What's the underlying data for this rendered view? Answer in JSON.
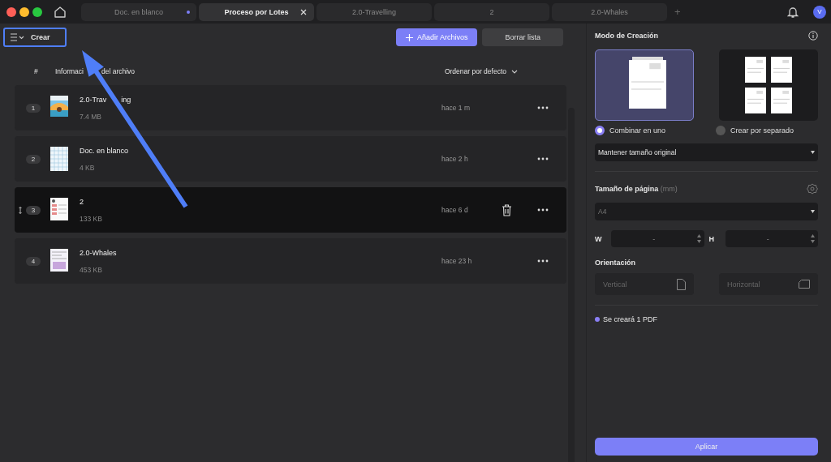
{
  "tabs": [
    {
      "label": "Doc. en blanco",
      "selected": false,
      "unsaved": true
    },
    {
      "label": "Proceso por Lotes",
      "selected": true,
      "unsaved": false
    },
    {
      "label": "2.0-Travelling",
      "selected": false,
      "unsaved": false
    },
    {
      "label": "2",
      "selected": false,
      "unsaved": false
    },
    {
      "label": "2.0-Whales",
      "selected": false,
      "unsaved": false
    }
  ],
  "new_tab": "+",
  "avatar": "V",
  "toolbar": {
    "menu_label": "Crear",
    "add_button": "Añadir Archivos",
    "clear_button": "Borrar lista"
  },
  "table": {
    "columns": [
      {
        "label_parts": [
          "#"
        ]
      },
      {
        "label_parts": [
          "Informaci",
          "del archivo"
        ]
      }
    ],
    "sort": "Ordenar por defecto",
    "rows": [
      {
        "index": "1",
        "name_parts": [
          "2.0-Trav",
          "ing"
        ],
        "size": "7.4 MB",
        "time": "hace 1 m",
        "hovered": false
      },
      {
        "index": "2",
        "name_parts": [
          "Doc. en blanco"
        ],
        "size": "4 KB",
        "time": "hace 2 h",
        "hovered": false
      },
      {
        "index": "3",
        "name_parts": [
          "2"
        ],
        "size": "133 KB",
        "time": "hace 6 d",
        "hovered": true
      },
      {
        "index": "4",
        "name_parts": [
          "2.0-Whales"
        ],
        "size": "453 KB",
        "time": "hace 23 h",
        "hovered": false
      }
    ]
  },
  "panel": {
    "title": "Modo de Creación",
    "modes": [
      {
        "kind": "single",
        "label": "Combinar en uno",
        "selected": true
      },
      {
        "kind": "multiple",
        "label": "Crear por separado",
        "selected": false
      }
    ],
    "size_mode": "Mantener tamaño original",
    "page_size_title": "Tamaño de página",
    "page_size_unit": "(mm)",
    "page_size": "A4",
    "width_label": "W",
    "width": "-",
    "height_label": "H",
    "height": "-",
    "orientation_title": "Orientación",
    "orientations": [
      {
        "kind": "portrait",
        "label": "Vertical",
        "disabled": true
      },
      {
        "kind": "landscape",
        "label": "Horizontal",
        "disabled": true
      }
    ],
    "note": "Se creará 1 PDF",
    "apply": "Aplicar"
  }
}
